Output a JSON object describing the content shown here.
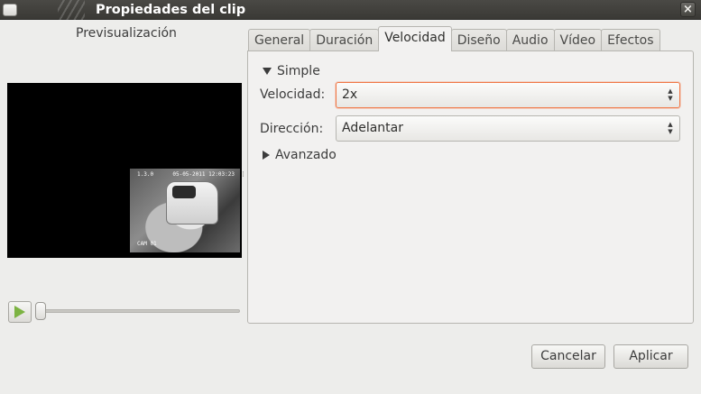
{
  "window": {
    "title": "Propiedades del clip",
    "close_glyph": "×"
  },
  "preview": {
    "label": "Previsualización",
    "overlay": {
      "top_left": "1.3.0",
      "top_right": "05-05-2011 12:03:23",
      "bottom_left": "CAM 01"
    },
    "seek_position": 0.0
  },
  "tabs": [
    {
      "label": "General",
      "active": false
    },
    {
      "label": "Duración",
      "active": false
    },
    {
      "label": "Velocidad",
      "active": true
    },
    {
      "label": "Diseño",
      "active": false
    },
    {
      "label": "Audio",
      "active": false
    },
    {
      "label": "Vídeo",
      "active": false
    },
    {
      "label": "Efectos",
      "active": false
    }
  ],
  "speed_panel": {
    "simple_label": "Simple",
    "speed_label": "Velocidad:",
    "speed_value": "2x",
    "direction_label": "Dirección:",
    "direction_value": "Adelantar",
    "advanced_label": "Avanzado"
  },
  "buttons": {
    "cancel": "Cancelar",
    "apply": "Aplicar"
  },
  "colors": {
    "focus_accent": "#f07746",
    "play_icon": "#7cb342",
    "titlebar": "#3c3b37"
  },
  "icons": {
    "play": "play-icon",
    "close": "close-icon",
    "expanded": "triangle-down-icon",
    "collapsed": "triangle-right-icon",
    "spinner": "up-down-arrows-icon"
  }
}
